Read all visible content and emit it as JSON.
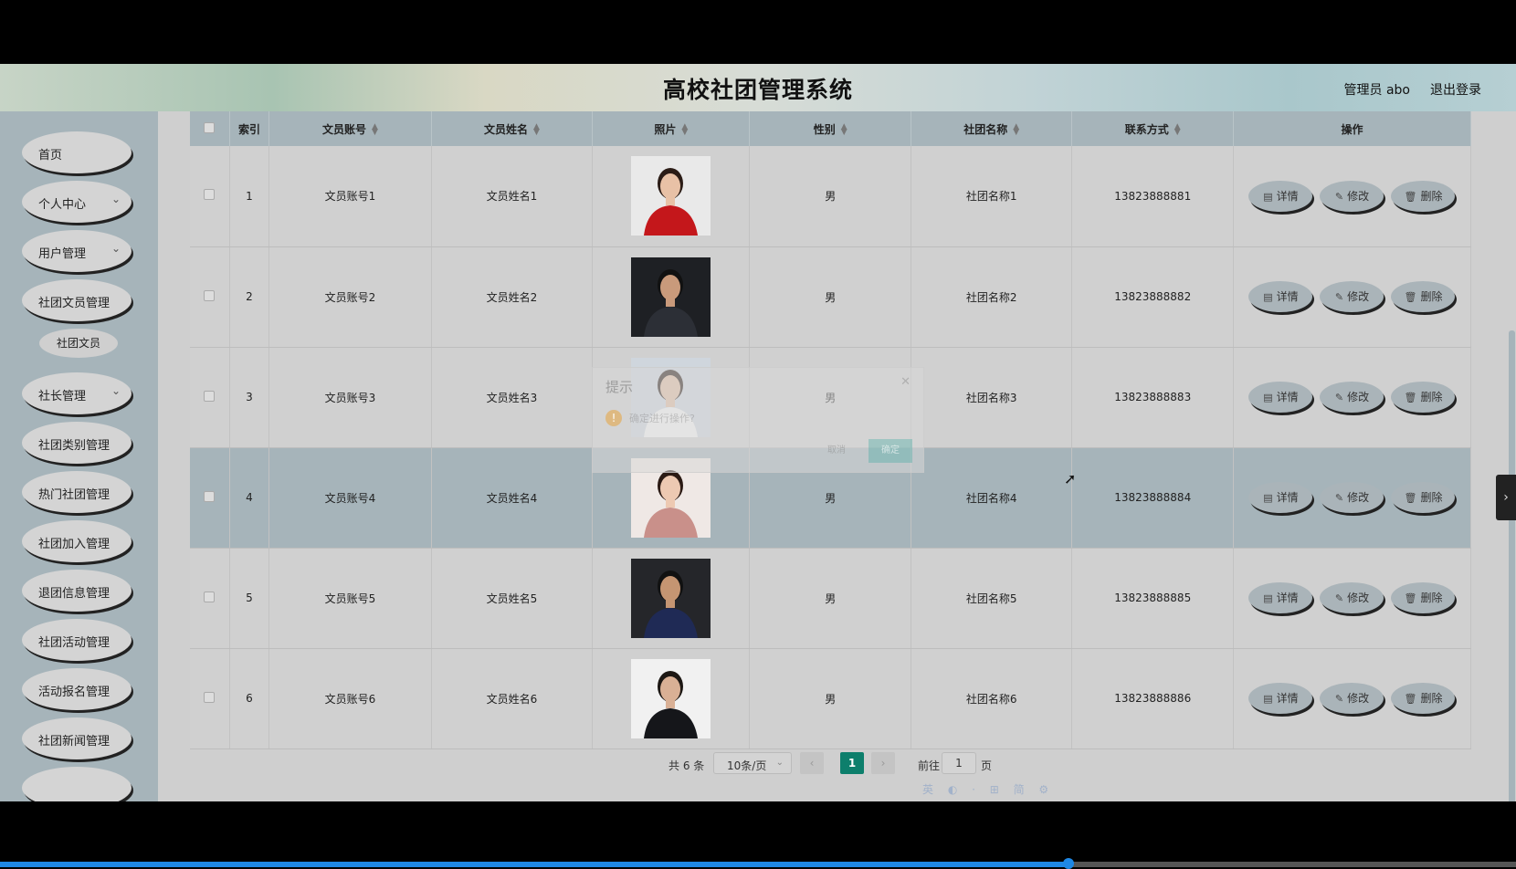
{
  "header": {
    "title": "高校社团管理系统",
    "admin": "管理员 abo",
    "logout": "退出登录"
  },
  "sidebar": {
    "items": [
      {
        "label": "首页",
        "has_sub": false
      },
      {
        "label": "个人中心",
        "has_sub": true
      },
      {
        "label": "用户管理",
        "has_sub": true
      },
      {
        "label": "社团文员管理",
        "has_sub": false
      },
      {
        "label": "社长管理",
        "has_sub": true
      },
      {
        "label": "社团类别管理",
        "has_sub": false
      },
      {
        "label": "热门社团管理",
        "has_sub": false
      },
      {
        "label": "社团加入管理",
        "has_sub": false
      },
      {
        "label": "退团信息管理",
        "has_sub": false
      },
      {
        "label": "社团活动管理",
        "has_sub": false
      },
      {
        "label": "活动报名管理",
        "has_sub": false
      },
      {
        "label": "社团新闻管理",
        "has_sub": false
      }
    ],
    "sub_item": "社团文员"
  },
  "table": {
    "columns": [
      "索引",
      "文员账号",
      "文员姓名",
      "照片",
      "性别",
      "社团名称",
      "联系方式",
      "操作"
    ],
    "rows": [
      {
        "index": "1",
        "account": "文员账号1",
        "name": "文员姓名1",
        "photo": "woman-red",
        "gender": "男",
        "club": "社团名称1",
        "phone": "13823888881"
      },
      {
        "index": "2",
        "account": "文员账号2",
        "name": "文员姓名2",
        "photo": "man-dark",
        "gender": "男",
        "club": "社团名称2",
        "phone": "13823888882"
      },
      {
        "index": "3",
        "account": "文员账号3",
        "name": "文员姓名3",
        "photo": "woman-white",
        "gender": "男",
        "club": "社团名称3",
        "phone": "13823888883"
      },
      {
        "index": "4",
        "account": "文员账号4",
        "name": "文员姓名4",
        "photo": "woman-pink",
        "gender": "男",
        "club": "社团名称4",
        "phone": "13823888884"
      },
      {
        "index": "5",
        "account": "文员账号5",
        "name": "文员姓名5",
        "photo": "man-blue",
        "gender": "男",
        "club": "社团名称5",
        "phone": "13823888885"
      },
      {
        "index": "6",
        "account": "文员账号6",
        "name": "文员姓名6",
        "photo": "man-white",
        "gender": "男",
        "club": "社团名称6",
        "phone": "13823888886"
      }
    ],
    "actions": {
      "detail": "详情",
      "edit": "修改",
      "delete": "删除"
    }
  },
  "pager": {
    "total": "共 6 条",
    "page_size": "10条/页",
    "current": "1",
    "goto_label": "前往",
    "goto_value": "1",
    "page_suffix": "页"
  },
  "dialog": {
    "title": "提示",
    "message": "确定进行操作?",
    "cancel": "取消",
    "ok": "确定"
  },
  "ime_bar": "英 ◐ · ⊞ 简 ⚙",
  "video_progress": 0.705
}
